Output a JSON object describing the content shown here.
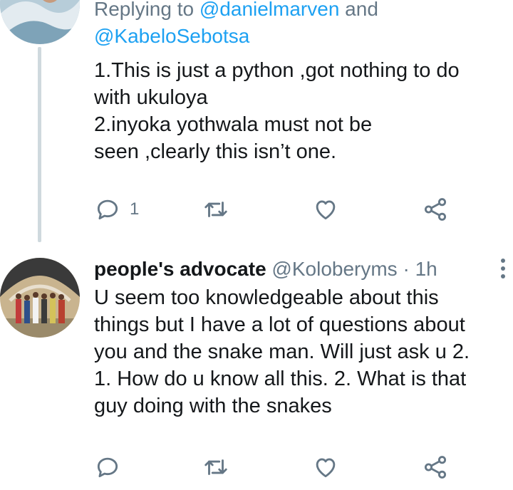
{
  "tweets": [
    {
      "reply_prefix": "Replying to ",
      "mention1": "@danielmarven",
      "conjunction": " and",
      "mention2": "@KabeloSebotsa",
      "text": "1.This is just a python ,got nothing to do\nwith ukuloya\n2.inyoka yothwala must not be\nseen ,clearly this isn’t one.",
      "reply_count": "1",
      "retweet_count": "",
      "like_count": ""
    },
    {
      "display_name": "people's advocate",
      "handle": "@Koloberyms",
      "separator": "·",
      "time": "1h",
      "text": "U seem too knowledgeable about this\nthings but I have a lot of questions about\nyou and the snake man. Will just ask u 2.\n1. How do u know all this. 2. What is that\nguy doing with the snakes",
      "reply_count": "",
      "retweet_count": "",
      "like_count": ""
    }
  ],
  "icons": {
    "reply": "reply-icon",
    "retweet": "retweet-icon",
    "like": "heart-icon",
    "share": "share-icon",
    "more": "more-vertical-icon"
  },
  "colors": {
    "text": "#14171a",
    "secondary": "#657786",
    "link": "#1da1f2",
    "icon": "#657786",
    "thread_line": "#cfd9de"
  }
}
